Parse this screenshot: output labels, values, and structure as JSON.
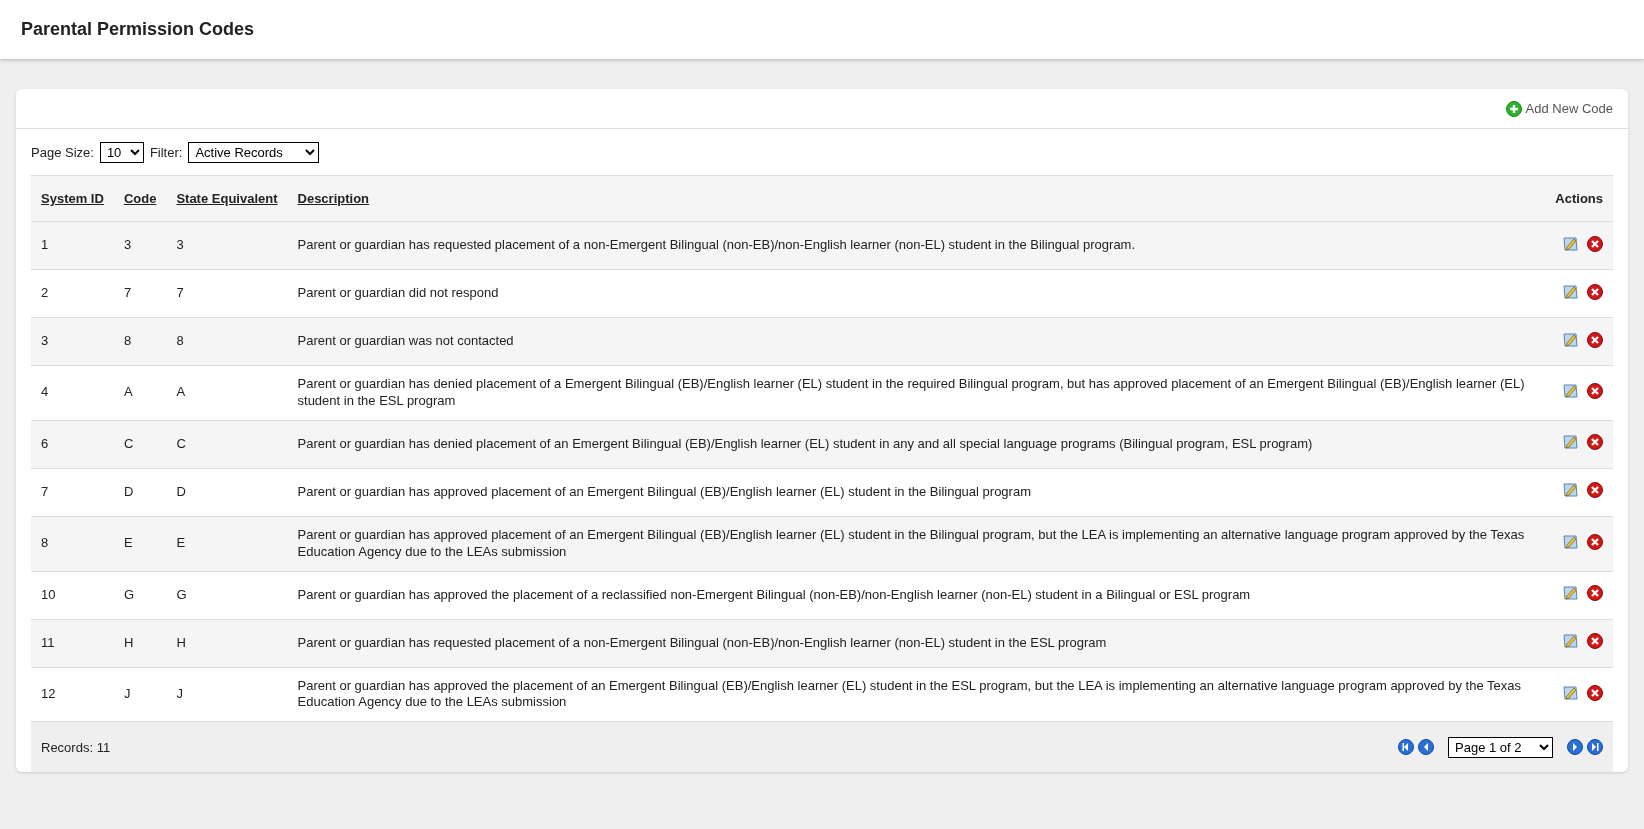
{
  "page_title": "Parental Permission Codes",
  "add_button": {
    "label": "Add New Code"
  },
  "controls": {
    "page_size_label": "Page Size:",
    "page_size": "10",
    "filter_label": "Filter:",
    "filter": "Active Records"
  },
  "table": {
    "columns": [
      "System ID",
      "Code",
      "State Equivalent",
      "Description",
      "Actions"
    ],
    "rows": [
      {
        "system_id": "1",
        "code": "3",
        "state_equivalent": "3",
        "description": "Parent or guardian has requested placement of a non-Emergent Bilingual (non-EB)/non-English learner (non-EL) student in the Bilingual program."
      },
      {
        "system_id": "2",
        "code": "7",
        "state_equivalent": "7",
        "description": "Parent or guardian did not respond"
      },
      {
        "system_id": "3",
        "code": "8",
        "state_equivalent": "8",
        "description": "Parent or guardian was not contacted"
      },
      {
        "system_id": "4",
        "code": "A",
        "state_equivalent": "A",
        "description": "Parent or guardian has denied placement of a Emergent Bilingual (EB)/English learner (EL) student in the required Bilingual program, but has approved placement of an Emergent Bilingual (EB)/English learner (EL) student in the ESL program"
      },
      {
        "system_id": "6",
        "code": "C",
        "state_equivalent": "C",
        "description": "Parent or guardian has denied placement of an Emergent Bilingual (EB)/English learner (EL) student in any and all special language programs (Bilingual program, ESL program)"
      },
      {
        "system_id": "7",
        "code": "D",
        "state_equivalent": "D",
        "description": "Parent or guardian has approved placement of an Emergent Bilingual (EB)/English learner (EL) student in the Bilingual program"
      },
      {
        "system_id": "8",
        "code": "E",
        "state_equivalent": "E",
        "description": "Parent or guardian has approved placement of an Emergent Bilingual (EB)/English learner (EL) student in the Bilingual program, but the LEA is implementing an alternative language program approved by the Texas Education Agency due to the LEAs submission"
      },
      {
        "system_id": "10",
        "code": "G",
        "state_equivalent": "G",
        "description": "Parent or guardian has approved the placement of a reclassified non-Emergent Bilingual (non-EB)/non-English learner (non-EL) student in a Bilingual or ESL program"
      },
      {
        "system_id": "11",
        "code": "H",
        "state_equivalent": "H",
        "description": "Parent or guardian has requested placement of a non-Emergent Bilingual (non-EB)/non-English learner (non-EL) student in the ESL program"
      },
      {
        "system_id": "12",
        "code": "J",
        "state_equivalent": "J",
        "description": "Parent or guardian has approved the placement of an Emergent Bilingual (EB)/English learner (EL) student in the ESL program, but the LEA is implementing an alternative language program approved by the Texas Education Agency due to the LEAs submission"
      }
    ]
  },
  "footer": {
    "records": "Records: 11",
    "page": "Page 1 of 2"
  }
}
